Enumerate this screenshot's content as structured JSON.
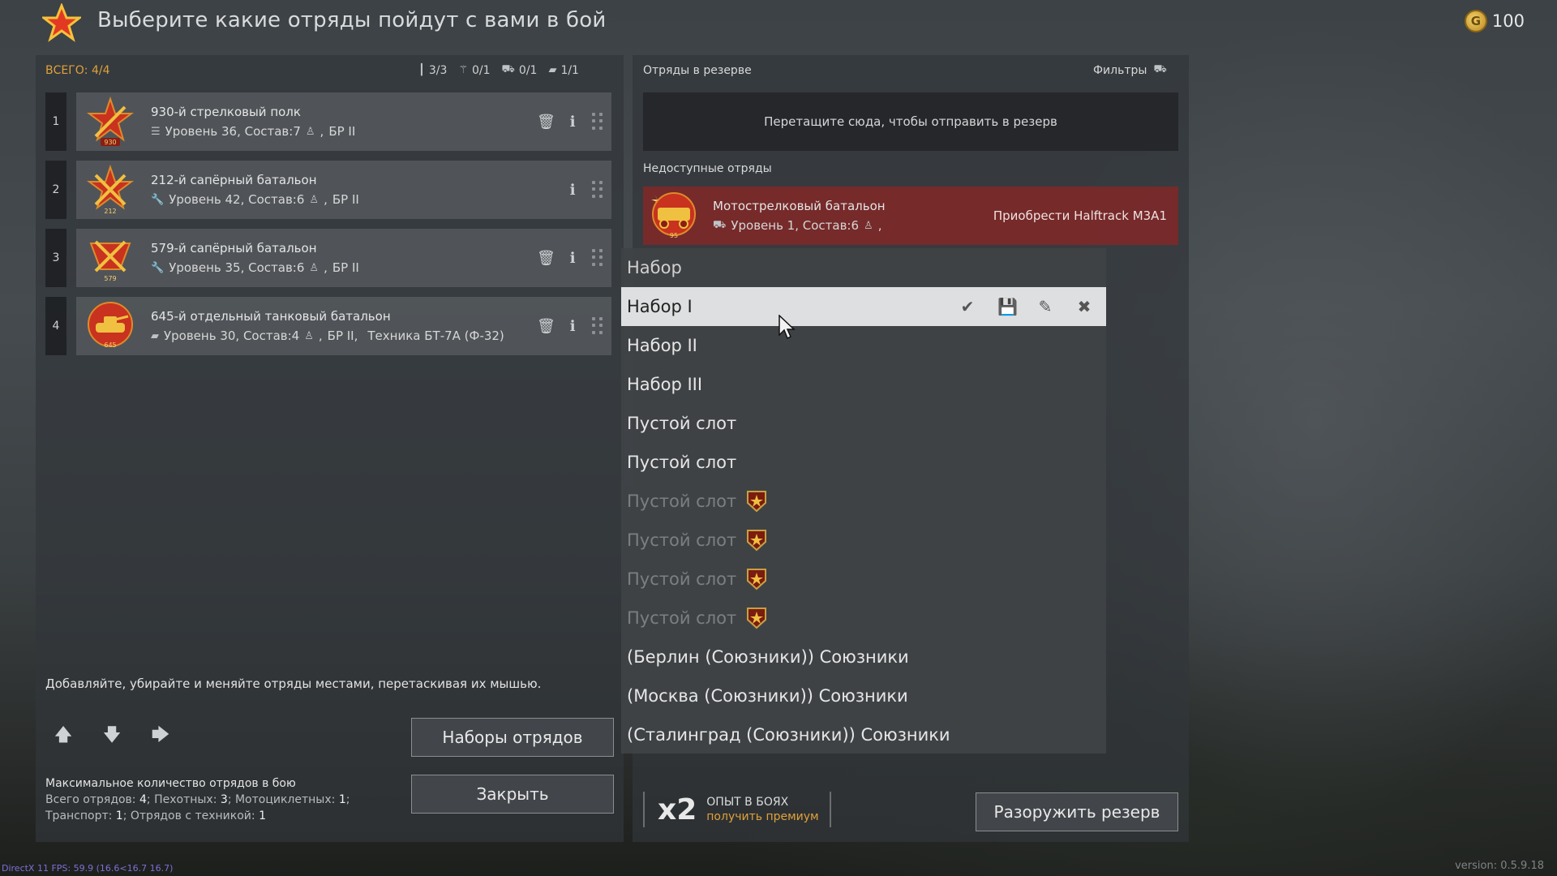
{
  "header": {
    "title": "Выберите какие отряды пойдут с вами в бой",
    "gold": "100"
  },
  "left": {
    "total": "ВСЕГО: 4/4",
    "counters": [
      "3/3",
      "0/1",
      "0/1",
      "1/1"
    ],
    "squads": [
      {
        "num": "1",
        "name": "930-й стрелковый полк",
        "meta": "Уровень 36, Состав:7",
        "br": "БР II",
        "badge": "930"
      },
      {
        "num": "2",
        "name": "212-й сапёрный батальон",
        "meta": "Уровень 42, Состав:6",
        "br": "БР II",
        "badge": "212"
      },
      {
        "num": "3",
        "name": "579-й сапёрный батальон",
        "meta": "Уровень 35, Состав:6",
        "br": "БР II",
        "badge": "579"
      },
      {
        "num": "4",
        "name": "645-й отдельный танковый батальон",
        "meta": "Уровень 30, Состав:4",
        "br": "БР II,",
        "tech": "Техника БТ-7А (Ф-32)",
        "badge": "645"
      }
    ],
    "hint": "Добавляйте, убирайте и меняйте отряды местами, перетаскивая их мышью.",
    "sets_button": "Наборы отрядов",
    "close_button": "Закрыть",
    "limits": {
      "title": "Максимальное количество отрядов в бою",
      "line2_a": "Всего отрядов: ",
      "total": "4",
      "line2_b": "; Пехотных: ",
      "infantry": "3",
      "line2_c": "; Мотоциклетных: ",
      "moto": "1",
      "line2_d": ";",
      "line3_a": "Транспорт: ",
      "transport": "1",
      "line3_b": "; Отрядов с техникой: ",
      "tech": "1"
    }
  },
  "right": {
    "reserve_title": "Отряды в резерве",
    "filters": "Фильтры",
    "drop_zone": "Перетащите сюда, чтобы отправить в резерв",
    "unavailable_title": "Недоступные отряды",
    "unavailable_squad": {
      "name": "Мотострелковый батальон",
      "meta": "Уровень 1, Состав:6",
      "buy": "Приобрести Halftrack M3A1",
      "badge": "95"
    },
    "premium": {
      "x2": "x2",
      "line1": "ОПЫТ В БОЯХ",
      "line2": "получить премиум"
    },
    "disarm_button": "Разоружить резерв"
  },
  "dropdown": {
    "header": "Набор",
    "items": [
      {
        "label": "Набор I",
        "state": "selected"
      },
      {
        "label": "Набор II",
        "state": "normal"
      },
      {
        "label": "Набор III",
        "state": "normal"
      },
      {
        "label": "Пустой слот",
        "state": "normal"
      },
      {
        "label": "Пустой слот",
        "state": "normal"
      },
      {
        "label": "Пустой слот",
        "state": "locked"
      },
      {
        "label": "Пустой слот",
        "state": "locked"
      },
      {
        "label": "Пустой слот",
        "state": "locked"
      },
      {
        "label": "Пустой слот",
        "state": "locked"
      },
      {
        "label": "(Берлин (Союзники)) Союзники",
        "state": "normal"
      },
      {
        "label": "(Москва (Союзники)) Союзники",
        "state": "normal"
      },
      {
        "label": "(Сталинград (Союзники)) Союзники",
        "state": "normal"
      }
    ]
  },
  "footer": {
    "fps": "DirectX 11 FPS: 59.9 (16.6<16.7 16.7)",
    "version": "version: 0.5.9.18"
  },
  "colors": {
    "accent": "#e0a13a",
    "unavailable": "#802828",
    "selected": "#dedfe0"
  }
}
